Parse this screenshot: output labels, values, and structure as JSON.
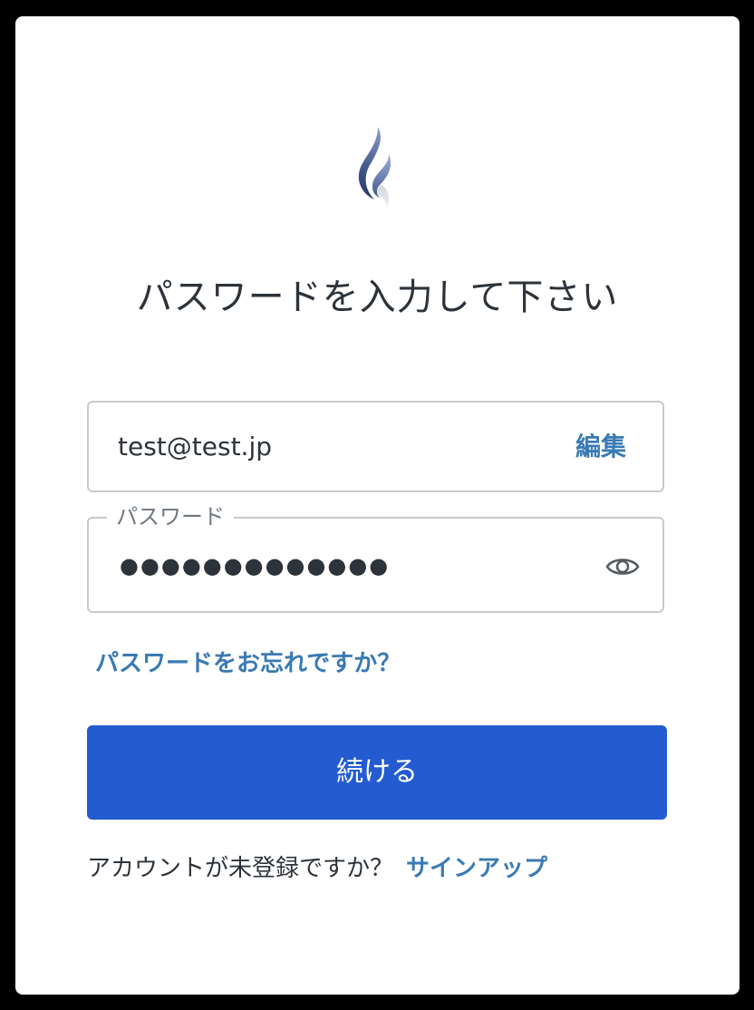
{
  "colors": {
    "accent": "#245bd1",
    "link": "#3a7ab3",
    "text": "#2d333a",
    "border": "#c9cace"
  },
  "logo": {
    "icon": "flame-logo-icon"
  },
  "title": "パスワードを入力して下さい",
  "email": {
    "value": "test@test.jp",
    "edit_label": "編集"
  },
  "password": {
    "label": "パスワード",
    "masked_value": "●●●●●●●●●●●●●",
    "toggle_icon": "eye-icon"
  },
  "forgot_password": "パスワードをお忘れですか？",
  "continue_label": "続ける",
  "signup": {
    "prompt": "アカウントが未登録ですか？",
    "link": "サインアップ"
  }
}
